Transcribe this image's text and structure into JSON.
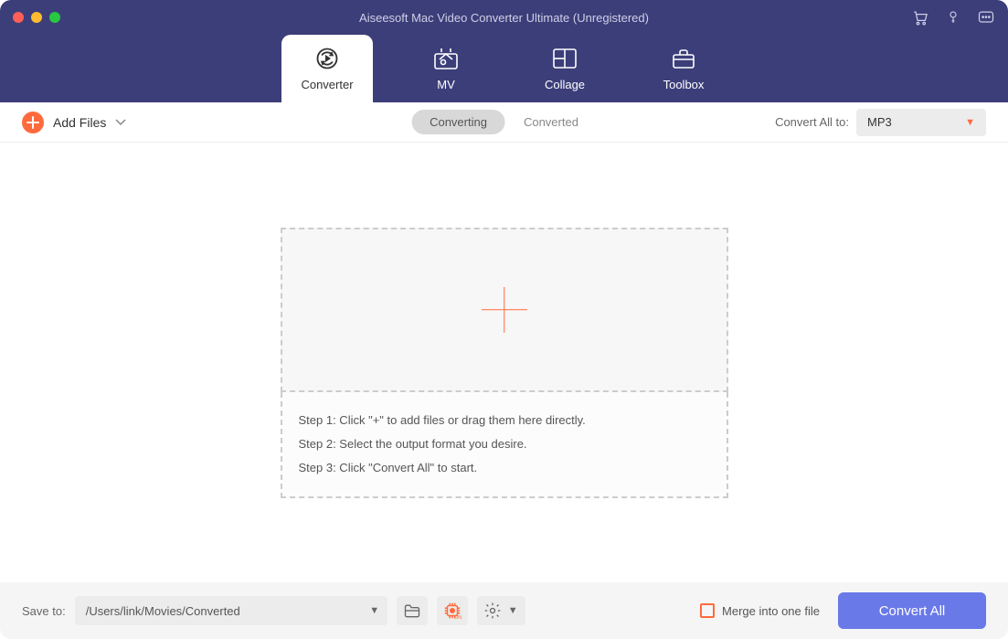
{
  "window": {
    "title": "Aiseesoft Mac Video Converter Ultimate (Unregistered)"
  },
  "tabs": {
    "converter": "Converter",
    "mv": "MV",
    "collage": "Collage",
    "toolbox": "Toolbox"
  },
  "toolbar": {
    "add_files": "Add Files",
    "converting": "Converting",
    "converted": "Converted",
    "convert_all_to_label": "Convert All to:",
    "format_selected": "MP3"
  },
  "dropzone": {
    "step1": "Step 1: Click \"+\" to add files or drag them here directly.",
    "step2": "Step 2: Select the output format you desire.",
    "step3": "Step 3: Click \"Convert All\" to start."
  },
  "bottom": {
    "save_to_label": "Save to:",
    "save_path": "/Users/link/Movies/Converted",
    "merge_label": "Merge into one file",
    "convert_all": "Convert All"
  }
}
